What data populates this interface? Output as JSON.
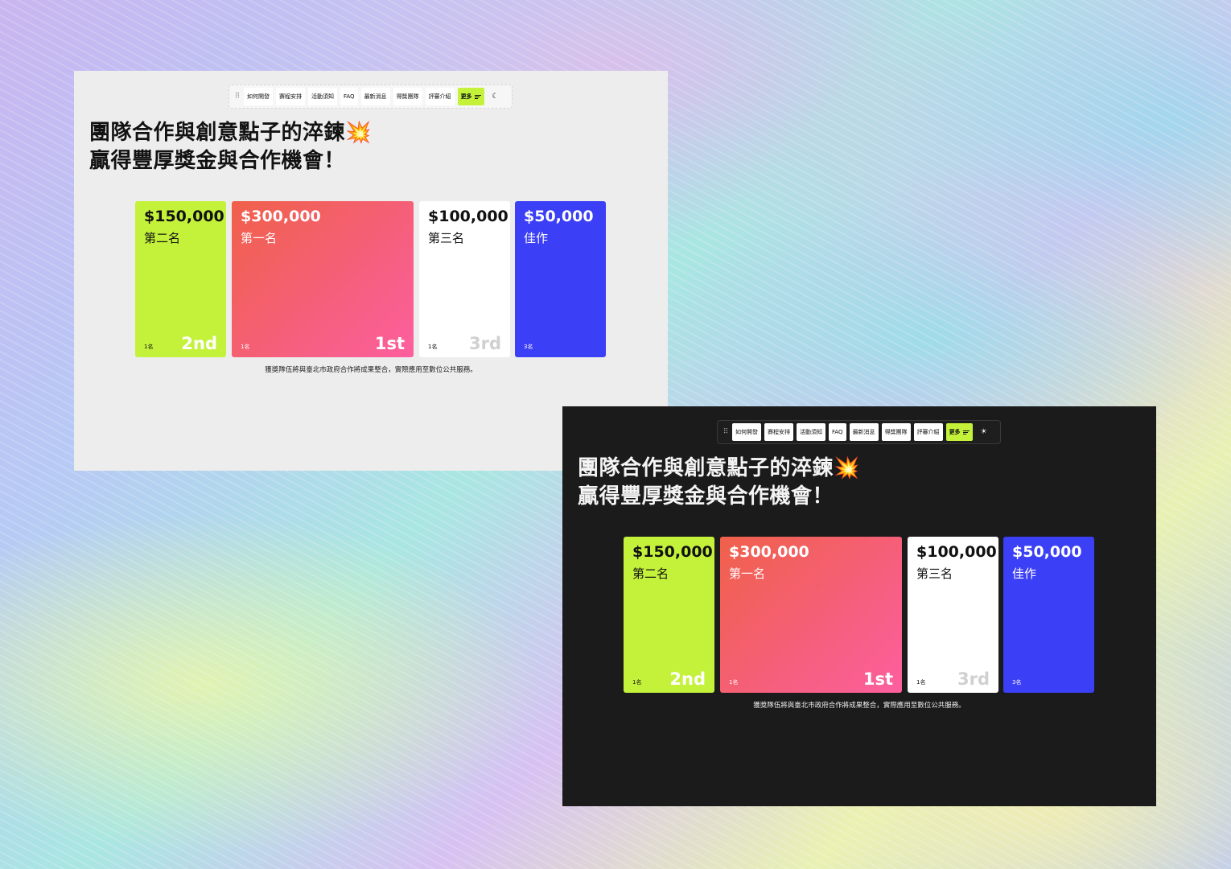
{
  "nav": {
    "items": [
      "如何開發",
      "賽程安排",
      "活動須知",
      "FAQ",
      "最新消息",
      "得獎團隊",
      "評審介紹"
    ],
    "more_label": "更多",
    "handle_icon": "drag-handle-icon",
    "light_theme_toggle_icon": "moon-icon",
    "dark_theme_toggle_icon": "sun-icon",
    "handle_glyph": "⠿",
    "moon_glyph": "☾",
    "sun_glyph": "☀",
    "accent": "#c4f23b"
  },
  "hero": {
    "line1": "團隊合作與創意點子的淬鍊",
    "burst": "💥",
    "line2": "贏得豐厚獎金與合作機會！"
  },
  "prizes": [
    {
      "amount": "$150,000",
      "rank": "第二名",
      "count": "1名",
      "ordinal": "2nd",
      "color": "#c4f23b"
    },
    {
      "amount": "$300,000",
      "rank": "第一名",
      "count": "1名",
      "ordinal": "1st",
      "color": "#f75f86"
    },
    {
      "amount": "$100,000",
      "rank": "第三名",
      "count": "1名",
      "ordinal": "3rd",
      "color": "#ffffff"
    },
    {
      "amount": "$50,000",
      "rank": "佳作",
      "count": "3名",
      "ordinal": "",
      "color": "#3b3ff5"
    }
  ],
  "footnote": "獲獎隊伍將與臺北市政府合作將成果整合，實際應用至數位公共服務。"
}
